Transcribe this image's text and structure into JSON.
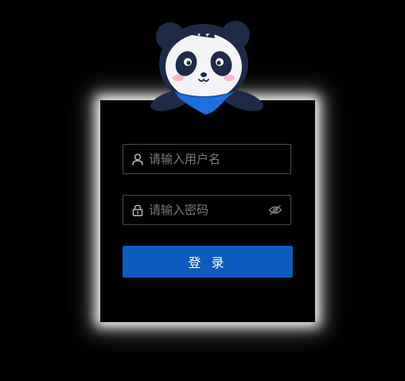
{
  "login": {
    "username_placeholder": "请输入用户名",
    "username_value": "",
    "password_placeholder": "请输入密码",
    "password_value": "",
    "submit_label": "登 录"
  },
  "icons": {
    "username": "user-icon",
    "password": "lock-icon",
    "visibility": "eye-hidden-icon",
    "mascot": "panda-mascot"
  },
  "colors": {
    "background": "#000000",
    "button": "#0b5cbd",
    "field_border": "#4a4a4a",
    "placeholder": "#7a7a7a",
    "mascot_scarf": "#1f6fe0"
  }
}
